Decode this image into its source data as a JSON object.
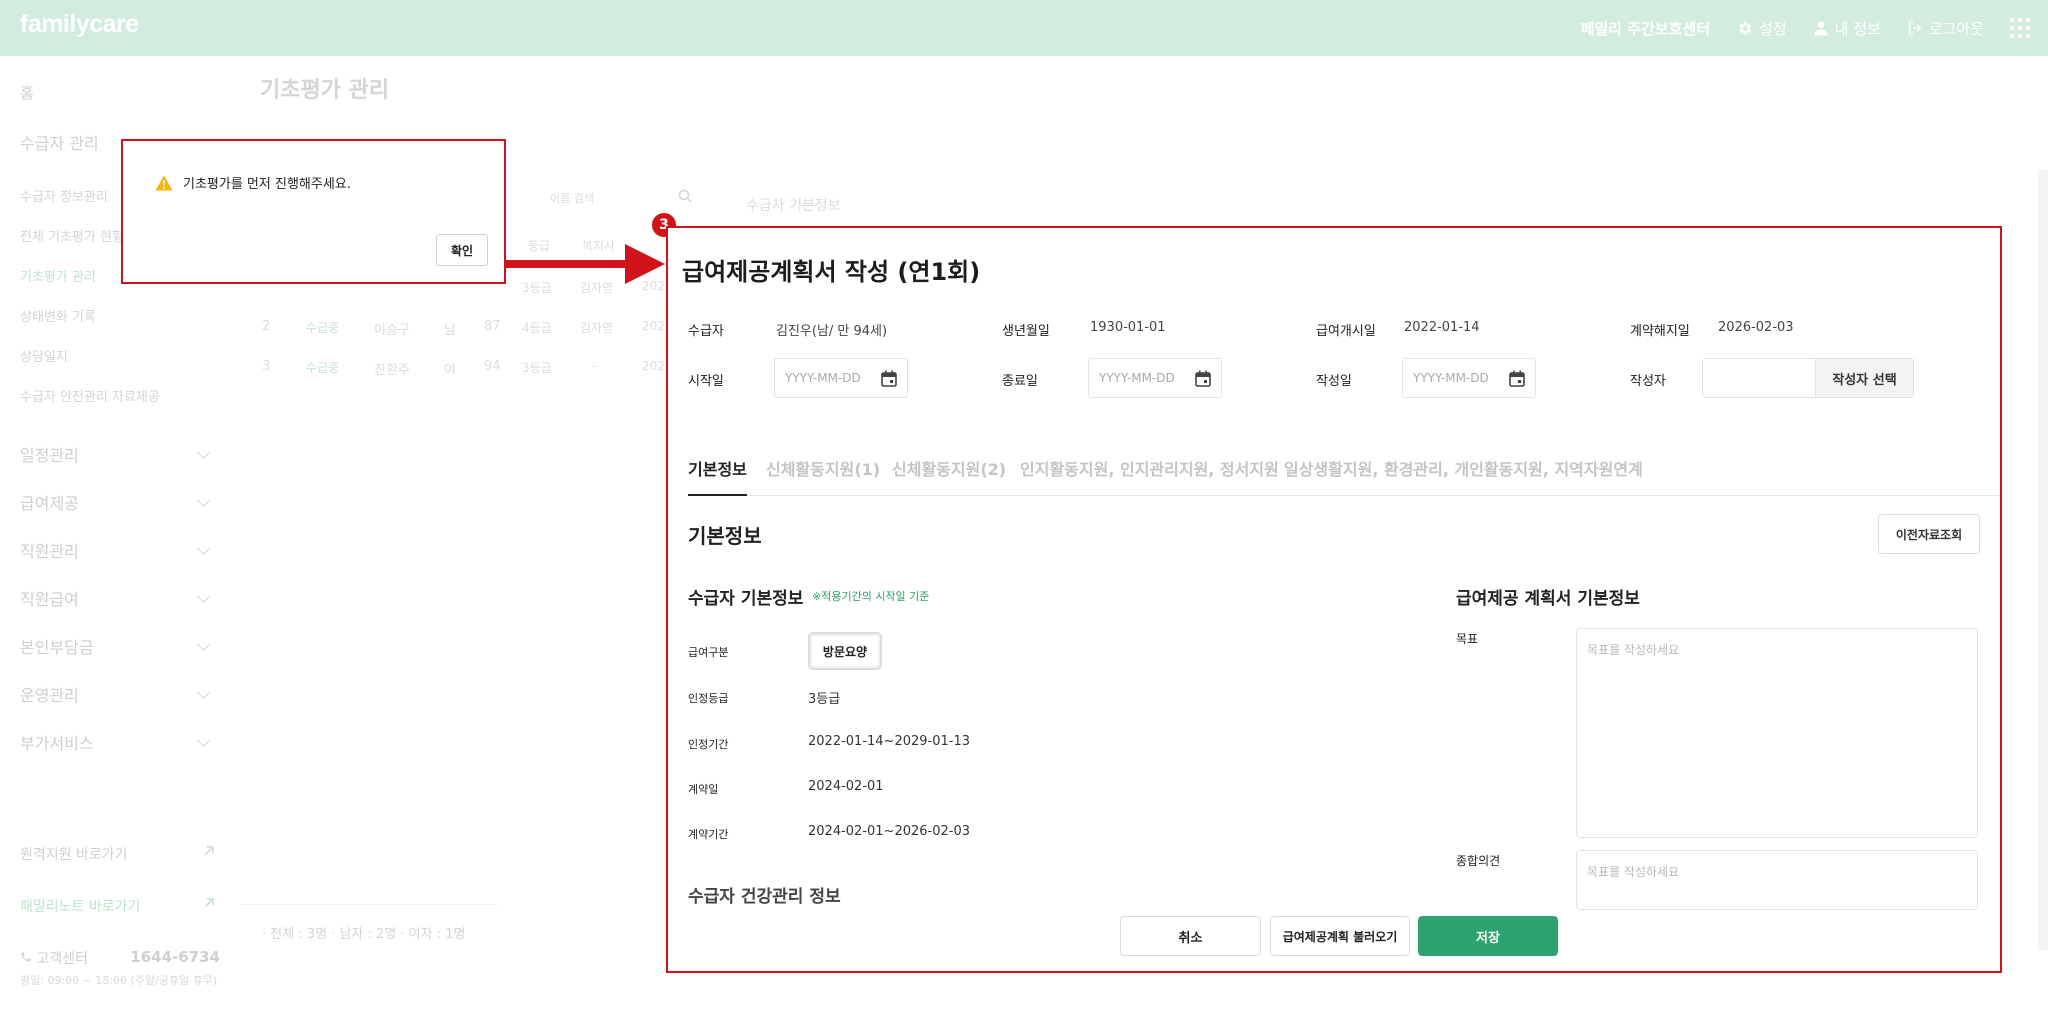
{
  "header": {
    "logo": "familycare",
    "center_name": "페밀리 주간보호센터",
    "settings": "설정",
    "my_info": "내 정보",
    "logout": "로그아웃"
  },
  "sidebar": {
    "home": "홈",
    "recipient_mgmt": "수급자 관리",
    "sub_items": [
      "수급자 정보관리",
      "전체 기초평가 현황",
      "기초평가 관리",
      "상태변화 기록",
      "상담일지",
      "수급자 안전관리 자료제공"
    ],
    "groups": [
      "일정관리",
      "급여제공",
      "직원관리",
      "직원급여",
      "본인부담금",
      "운영관리",
      "부가서비스"
    ],
    "remote_support": "원격지원 바로가기",
    "family_note": "패밀리노트 바로가기",
    "customer_center": "고객센터",
    "phone": "1644-6734",
    "hours": "평일: 09:00 ~ 18:00 (주말/공휴일 휴무)"
  },
  "background": {
    "page_title": "기초평가 관리",
    "search_placeholder": "이름 검색",
    "right_panel_title": "수급자 기본정보",
    "col_grade": "등급",
    "col_worker": "복지사",
    "rows": [
      {
        "no": "2",
        "type": "수급중",
        "name": "이승구",
        "sex": "남",
        "age": "87",
        "grade": "4등급",
        "worker": "김자영",
        "date": "202"
      },
      {
        "no": "3",
        "type": "수급중",
        "name": "진환주",
        "sex": "여",
        "age": "94",
        "grade": "3등급",
        "worker": "-",
        "date": "202"
      }
    ],
    "row1_grade": "3등급",
    "row1_worker": "김자영",
    "row1_date": "202",
    "summary": "· 전체 : 3명    · 남자 : 2명    · 여자 : 1명"
  },
  "alert": {
    "message": "기초평가를 먼저 진행해주세요.",
    "confirm": "확인"
  },
  "step_badge": "3",
  "modal": {
    "title": "급여제공계획서 작성 (연1회)",
    "info": {
      "recipient_label": "수급자",
      "recipient_value": "김진우(남/ 만 94세)",
      "birth_label": "생년월일",
      "birth_value": "1930-01-01",
      "start_benefit_label": "급여개시일",
      "start_benefit_value": "2022-01-14",
      "contract_end_label": "계약해지일",
      "contract_end_value": "2026-02-03",
      "start_date_label": "시작일",
      "end_date_label": "종료일",
      "written_date_label": "작성일",
      "writer_label": "작성자",
      "date_placeholder": "YYYY-MM-DD",
      "writer_select": "작성자 선택"
    },
    "tabs": [
      "기본정보",
      "신체활동지원(1)",
      "신체활동지원(2)",
      "인지활동지원, 인지관리지원, 정서지원",
      "일상생활지원, 환경관리, 개인활동지원, 지역자원연계"
    ],
    "section_title": "기본정보",
    "prev_data_button": "이전자료조회",
    "recipient_basic": {
      "title": "수급자 기본정보",
      "note": "※적용기간의 시작일 기준",
      "benefit_type_label": "급여구분",
      "benefit_type_value": "방문요양",
      "grade_label": "인정등급",
      "grade_value": "3등급",
      "cert_period_label": "인정기간",
      "cert_period_value": "2022-01-14~2029-01-13",
      "contract_date_label": "계약일",
      "contract_date_value": "2024-02-01",
      "contract_period_label": "계약기간",
      "contract_period_value": "2024-02-01~2026-02-03",
      "next_section_partial": "수급자 건강관리 정보"
    },
    "plan_basic": {
      "title": "급여제공 계획서 기본정보",
      "goal_label": "목표",
      "goal_placeholder": "목표를 작성하세요",
      "opinion_label": "종합의견",
      "opinion_placeholder": "목표를 작성하세요"
    },
    "buttons": {
      "cancel": "취소",
      "load": "급여제공계획 불러오기",
      "save": "저장"
    }
  },
  "colors": {
    "header_bg": "#d3ece0",
    "accent_green": "#2ea36f",
    "highlight_red": "#d0121b"
  }
}
